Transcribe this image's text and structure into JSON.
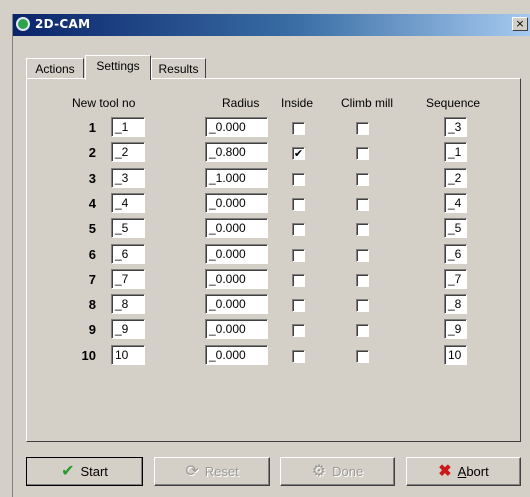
{
  "window": {
    "title": "2D-CAM",
    "close_glyph": "×"
  },
  "tabs": [
    {
      "label": "Actions"
    },
    {
      "label": "Settings"
    },
    {
      "label": "Results"
    }
  ],
  "columns": {
    "tool_no": "New tool no",
    "radius": "Radius",
    "inside": "Inside",
    "climb": "Climb mill",
    "sequence": "Sequence"
  },
  "rows": [
    {
      "num": "1",
      "tool": "_1",
      "radius": "_0.000",
      "inside": false,
      "climb": false,
      "seq": "_3"
    },
    {
      "num": "2",
      "tool": "_2",
      "radius": "_0.800",
      "inside": true,
      "climb": false,
      "seq": "_1"
    },
    {
      "num": "3",
      "tool": "_3",
      "radius": "_1.000",
      "inside": false,
      "climb": false,
      "seq": "_2"
    },
    {
      "num": "4",
      "tool": "_4",
      "radius": "_0.000",
      "inside": false,
      "climb": false,
      "seq": "_4"
    },
    {
      "num": "5",
      "tool": "_5",
      "radius": "_0.000",
      "inside": false,
      "climb": false,
      "seq": "_5"
    },
    {
      "num": "6",
      "tool": "_6",
      "radius": "_0.000",
      "inside": false,
      "climb": false,
      "seq": "_6"
    },
    {
      "num": "7",
      "tool": "_7",
      "radius": "_0.000",
      "inside": false,
      "climb": false,
      "seq": "_7"
    },
    {
      "num": "8",
      "tool": "_8",
      "radius": "_0.000",
      "inside": false,
      "climb": false,
      "seq": "_8"
    },
    {
      "num": "9",
      "tool": "_9",
      "radius": "_0.000",
      "inside": false,
      "climb": false,
      "seq": "_9"
    },
    {
      "num": "10",
      "tool": "10",
      "radius": "_0.000",
      "inside": false,
      "climb": false,
      "seq": "10"
    }
  ],
  "buttons": {
    "start": "Start",
    "reset": "Reset",
    "done": "Done",
    "abort": "Abort"
  },
  "icons": {
    "start": "check-icon",
    "reset": "refresh-icon",
    "done": "gears-icon",
    "abort": "x-icon"
  },
  "colors": {
    "face": "#d4d0c8",
    "title_start": "#0a246a",
    "start_icon": "#2a9a2a",
    "abort_icon": "#cc1a1a"
  }
}
